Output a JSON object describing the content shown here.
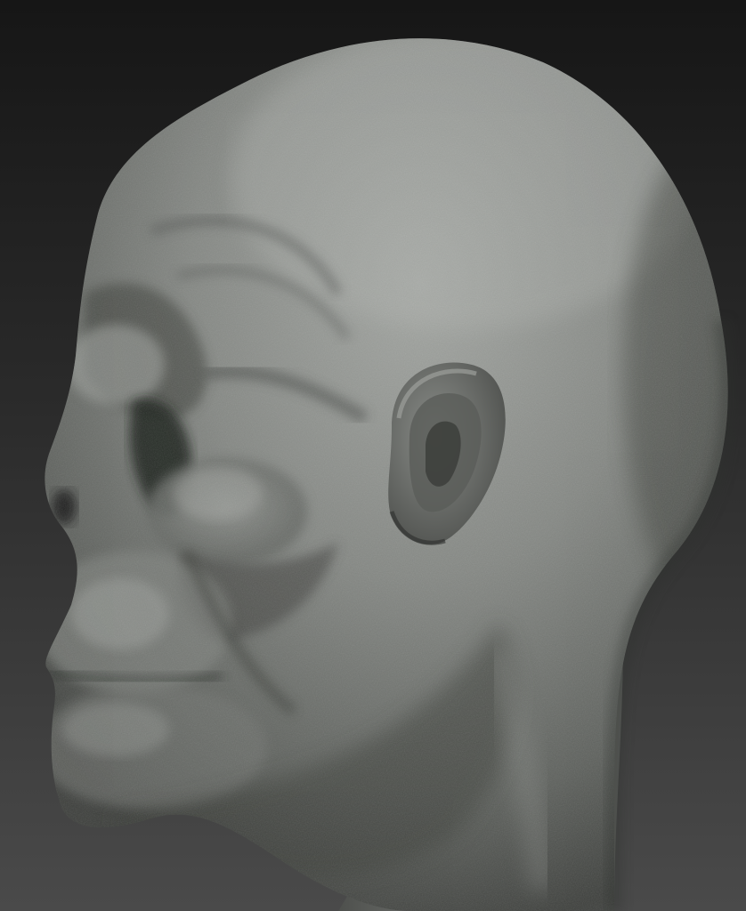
{
  "scene": {
    "subject": "sculpted-bald-head-profile",
    "view": "left-side-profile",
    "material": "matte-grey-clay"
  },
  "colors": {
    "background_top": "#161616",
    "background_bottom": "#4a4a4a",
    "skin_highlight": "#9a9d99",
    "skin_mid": "#7a7d79",
    "skin_shadow": "#3c3e3c",
    "crevice_shadow": "#1f201f"
  }
}
